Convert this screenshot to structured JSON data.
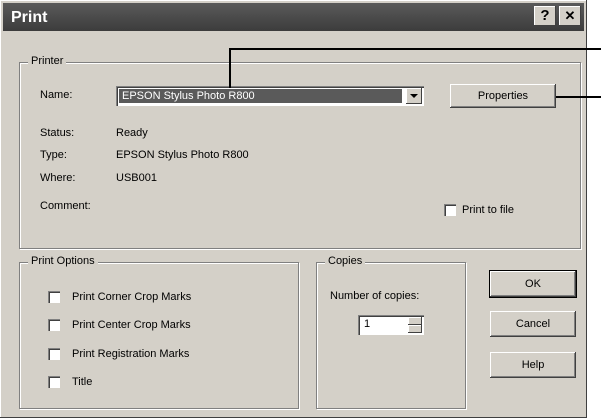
{
  "window": {
    "title": "Print",
    "help_button": "?",
    "close_button": "✕"
  },
  "printer": {
    "group_label": "Printer",
    "name_label": "Name:",
    "name_value": "EPSON Stylus Photo R800",
    "properties_button": "Properties",
    "status_label": "Status:",
    "status_value": "Ready",
    "type_label": "Type:",
    "type_value": "EPSON Stylus Photo R800",
    "where_label": "Where:",
    "where_value": "USB001",
    "comment_label": "Comment:",
    "print_to_file_label": "Print to file"
  },
  "print_options": {
    "group_label": "Print Options",
    "items": [
      {
        "label": "Print Corner Crop Marks",
        "checked": false
      },
      {
        "label": "Print Center Crop Marks",
        "checked": false
      },
      {
        "label": "Print Registration Marks",
        "checked": false
      },
      {
        "label": "Title",
        "checked": false
      }
    ]
  },
  "copies": {
    "group_label": "Copies",
    "number_label": "Number of copies:",
    "value": "1"
  },
  "buttons": {
    "ok": "OK",
    "cancel": "Cancel",
    "help": "Help"
  }
}
